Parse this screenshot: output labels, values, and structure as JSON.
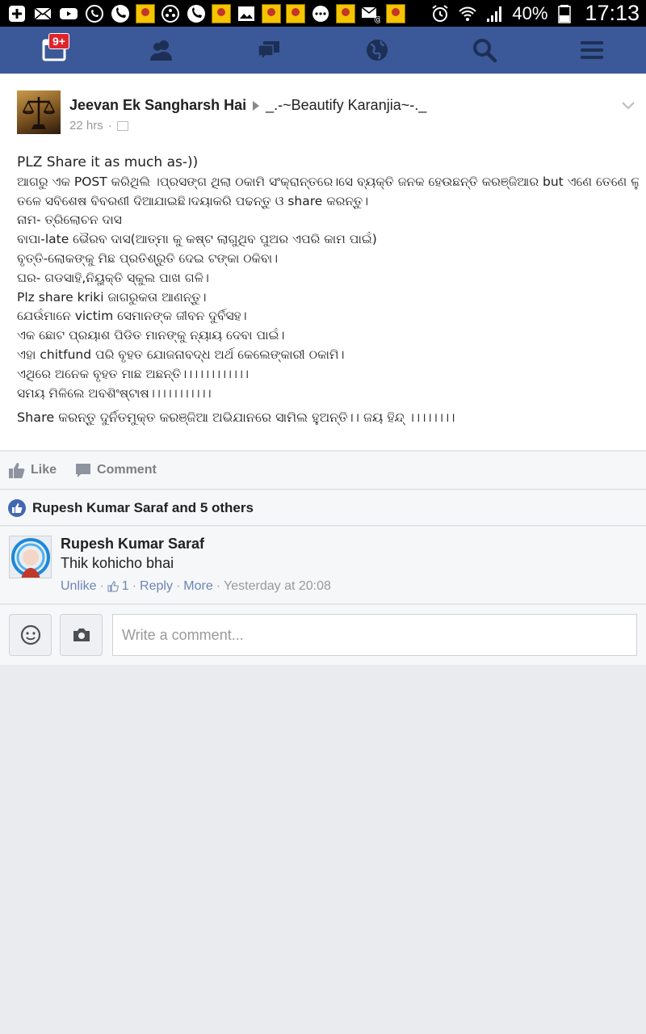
{
  "status_bar": {
    "battery": "40%",
    "time": "17:13"
  },
  "nav": {
    "notification_badge": "9+",
    "tabs": [
      "news-feed",
      "friend-requests",
      "messages",
      "notifications",
      "search",
      "more"
    ]
  },
  "post": {
    "author": "Jeevan Ek Sangharsh Hai",
    "group": "_.-~Beautify Karanjia~-._",
    "time": "22 hrs",
    "lines": [
      "PLZ Share it as much as-))",
      "ଆଗରୁ ଏକ POST କରିଥିଲି ।ପ୍ରସଙ୍ଗ ଥିଲା ଠକାମି ସଂକ୍ରାନ୍ତରେ।ସେ ବ୍ୟକ୍ତି ଜନକ ହେଉଛନ୍ତି କରଞ୍ଜିଆର but ଏଣେ ତେଣେ ଲୁଚିକି ବୁଲନ୍ତି।",
      "ତଳେ ସବିଶେଷ ବିବରଣୀ ଦିଆଯାଇଛି।ଦୟାକରି ପଢନ୍ତୁ ଓ share କରନ୍ତୁ।",
      "ନାମ- ତ୍ରିଲୋଚନ ଦାସ",
      "ବାପା-late ଭୈରବ ଦାସ(ଆତ୍ମା କୁ କଷ୍ଟ ଲାଗୁଥିବ ପୁଅର ଏପରି କାମ ପାଇଁ)",
      "ବୃତ୍ତି-ଲୋକଙ୍କୁ ମିଛ ପ୍ରତିଶ୍ରୁତି ଦେଇ ଟଙ୍କା ଠକିବା।",
      "ଘର- ଗଡସାହି,ନିୟୁକ୍ତି ସ୍କୁଲ ପାଖ ଗଳି।",
      "Plz share kriki ଜାଗରୁକତା ଆଣନ୍ତୁ।",
      "ଯେଉଁମାନେ victim ସେମାନଙ୍କ ଜୀବନ ଦୁର୍ବିସହ।",
      "ଏକ ଛୋଟ ପ୍ରୟାଶ ପିଡିତ ମାନଙ୍କୁ ନ୍ୟାୟ ଦେବା ପାଇଁ।",
      "ଏହା chitfund ପରି ବୃହତ ଯୋଜନାବଦ୍ଧ ଅର୍ଥ କେଲେଙ୍କାରୀ ଠକାମି।",
      "ଏଥିରେ ଅନେକ ବୃହତ ମାଛ ଅଛନ୍ତି।।।।।।।।।।।।",
      "ସମୟ ମିଳିଲେ ଅବଶିଂଷ୍ଟାଷ।।।।।।।।।।।",
      "Share କରନ୍ତୁ ଦୁର୍ନିତମୁକ୍ତ କରଞ୍ଜିଆ ଅଭିଯାନରେ ସାମିଲ ହୁଅନ୍ତି।। ଜୟ ହିନ୍ଦ୍ ।।।।।।।।"
    ]
  },
  "actions": {
    "like": "Like",
    "comment": "Comment"
  },
  "likes_summary": "Rupesh Kumar Saraf and 5 others",
  "comment": {
    "author": "Rupesh Kumar Saraf",
    "text": "Thik kohicho bhai",
    "unlike": "Unlike",
    "like_count": "1",
    "reply": "Reply",
    "more": "More",
    "time": "Yesterday at 20:08"
  },
  "composer": {
    "placeholder": "Write a comment..."
  },
  "colors": {
    "brand": "#3b5998",
    "link": "#6d84b4"
  }
}
